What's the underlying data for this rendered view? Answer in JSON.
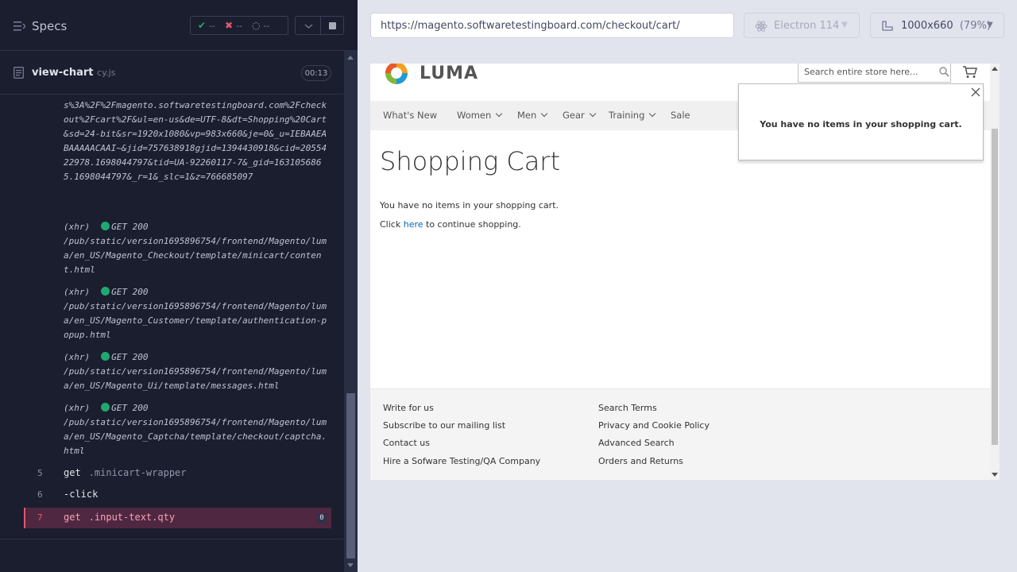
{
  "runner": {
    "specs_label": "Specs",
    "stats": {
      "passed": "--",
      "failed": "--",
      "pending": "--"
    },
    "spec_file": {
      "name": "view-chart",
      "ext": "cy.js"
    },
    "timer": "00:13",
    "log": {
      "url_continuation": "s%3A%2F%2Fmagento.softwaretestingboard.com%2Fcheckout%2Fcart%2F&ul=en-us&de=UTF-8&dt=Shopping%20Cart&sd=24-bit&sr=1920x1080&vp=983x660&je=0&_u=IEBAAEABAAAAACAAI~&jid=757638918gjid=1394430918&cid=2055422978.1698044797&tid=UA-92260117-7&_gid=1631056865.1698044797&_r=1&_slc=1&z=766685097",
      "xhr": [
        {
          "type": "(xhr)",
          "status": "GET 200",
          "url": "/pub/static/version1695896754/frontend/Magento/luma/en_US/Magento_Checkout/template/minicart/content.html"
        },
        {
          "type": "(xhr)",
          "status": "GET 200",
          "url": "/pub/static/version1695896754/frontend/Magento/luma/en_US/Magento_Customer/template/authentication-popup.html"
        },
        {
          "type": "(xhr)",
          "status": "GET 200",
          "url": "/pub/static/version1695896754/frontend/Magento/luma/en_US/Magento_Ui/template/messages.html"
        },
        {
          "type": "(xhr)",
          "status": "GET 200",
          "url": "/pub/static/version1695896754/frontend/Magento/luma/en_US/Magento_Captcha/template/checkout/captcha.html"
        }
      ],
      "commands": [
        {
          "num": "5",
          "name": "get",
          "arg": ".minicart-wrapper"
        },
        {
          "num": "6",
          "name": "-click",
          "arg": ""
        },
        {
          "num": "7",
          "name": "get",
          "arg": ".input-text.qty",
          "badge": "0"
        }
      ]
    }
  },
  "browser": {
    "url": "https://magento.softwaretestingboard.com/checkout/cart/",
    "name": "Electron 114",
    "viewport": "1000x660",
    "zoom": "(79%)"
  },
  "site": {
    "logo_text": "LUMA",
    "search_placeholder": "Search entire store here...",
    "nav": [
      "What's New",
      "Women",
      "Men",
      "Gear",
      "Training",
      "Sale"
    ],
    "page_title": "Shopping Cart",
    "empty_message": "You have no items in your shopping cart.",
    "continue_prefix": "Click",
    "continue_link": "here",
    "continue_suffix": "to continue shopping.",
    "minicart_message": "You have no items in your shopping cart.",
    "footer_col1": [
      "Write for us",
      "Subscribe to our mailing list",
      "Contact us",
      "Hire a Sofware Testing/QA Company"
    ],
    "footer_col2": [
      "Search Terms",
      "Privacy and Cookie Policy",
      "Advanced Search",
      "Orders and Returns"
    ]
  },
  "colors": {
    "runner_bg": "#1b1e2e",
    "success": "#1fa971",
    "failure": "#e45770",
    "link": "#006bb4"
  }
}
